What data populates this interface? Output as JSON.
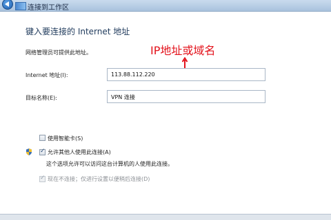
{
  "window": {
    "title": "连接到工作区"
  },
  "heading": "键入要连接的 Internet 地址",
  "hint": "网络管理员可提供此地址。",
  "annotation": "IP地址或域名",
  "fields": {
    "address_label": "Internet 地址(I):",
    "address_value": "113.88.112.220",
    "dest_label": "目标名称(E):",
    "dest_value": "VPN 连接"
  },
  "options": {
    "smartcard_label": "使用智能卡(S)",
    "smartcard_checked": false,
    "allow_label": "允许其他人使用此连接(A)",
    "allow_checked": true,
    "allow_desc": "这个选项允许可以访问这台计算机的人使用此连接。",
    "dontconnect_label": "现在不连接；仅进行设置以便稍后连接(D)",
    "dontconnect_checked": true
  },
  "colors": {
    "annotation": "#e3121b",
    "heading": "#1e395b"
  }
}
